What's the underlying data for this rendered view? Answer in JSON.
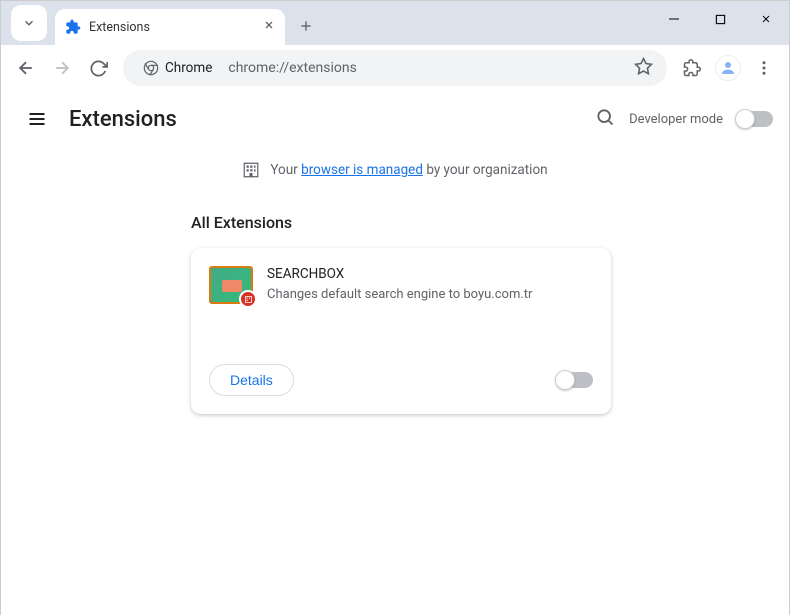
{
  "tab": {
    "title": "Extensions"
  },
  "omnibox": {
    "chip_label": "Chrome",
    "url": "chrome://extensions"
  },
  "page": {
    "title": "Extensions",
    "developer_mode_label": "Developer mode",
    "managed_prefix": "Your ",
    "managed_link": "browser is managed",
    "managed_suffix": " by your organization",
    "section_title": "All Extensions"
  },
  "extension": {
    "name": "SEARCHBOX",
    "description": "Changes default search engine to boyu.com.tr",
    "details_label": "Details"
  }
}
